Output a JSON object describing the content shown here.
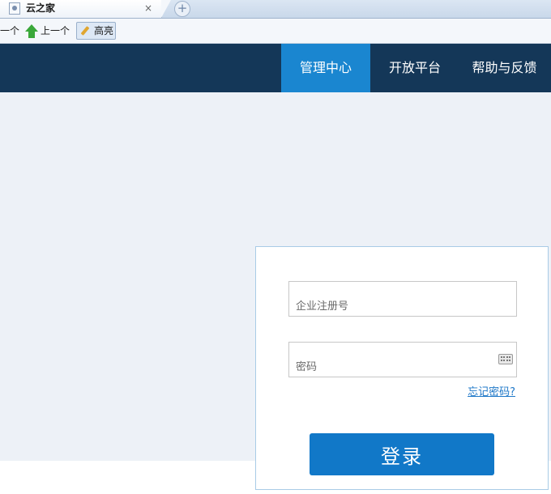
{
  "browser": {
    "tab_title": "云之家",
    "tab_close": "×",
    "new_tab": "+"
  },
  "find_toolbar": {
    "next_label": "一个",
    "previous_label": "上一个",
    "highlight_label": "高亮"
  },
  "header": {
    "nav": [
      {
        "label": "管理中心",
        "active": true
      },
      {
        "label": "开放平台",
        "active": false
      },
      {
        "label": "帮助与反馈",
        "active": false
      }
    ]
  },
  "login": {
    "company_placeholder": "企业注册号",
    "password_placeholder": "密码",
    "forgot_password": "忘记密码?",
    "submit_label": "登录"
  },
  "colors": {
    "header_bg": "#143758",
    "nav_active": "#1a86d0",
    "page_bg": "#edf1f7",
    "button": "#1178c8",
    "link": "#1f78c8"
  },
  "icons": [
    "page-icon",
    "close-icon",
    "add-tab-icon",
    "up-arrow-icon",
    "pencil-icon",
    "keyboard-icon"
  ]
}
